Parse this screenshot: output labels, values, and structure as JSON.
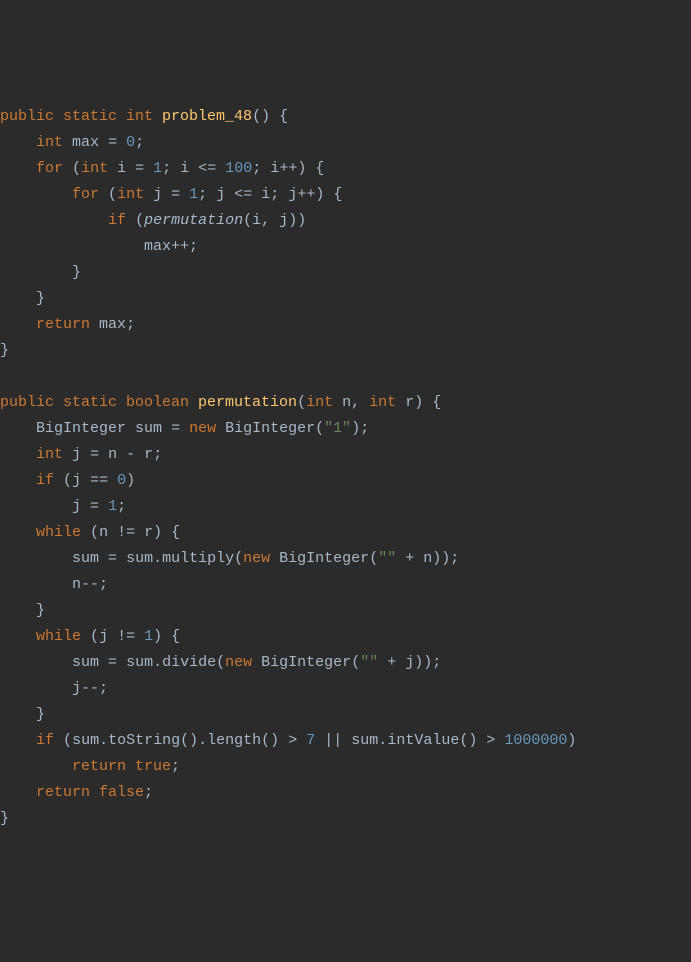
{
  "code": {
    "fn1_mods": "public static int",
    "fn1_name": "problem_48",
    "fn1_l1_type": "int",
    "fn1_l1_var": "max",
    "fn1_l1_val": "0",
    "fn1_for_kw": "for",
    "fn1_for_init_type": "int",
    "fn1_for_init_var": "i",
    "fn1_for_init_val": "1",
    "fn1_for_cond_var": "i",
    "fn1_for_cond_val": "100",
    "fn1_for_inc": "i++",
    "fn1_for2_init_type": "int",
    "fn1_for2_init_var": "j",
    "fn1_for2_init_val": "1",
    "fn1_for2_cond_var": "j",
    "fn1_for2_cond_rhs": "i",
    "fn1_for2_inc": "j++",
    "fn1_if_kw": "if",
    "fn1_if_call": "permutation",
    "fn1_if_arg1": "i",
    "fn1_if_arg2": "j",
    "fn1_inc": "max++",
    "fn1_ret_kw": "return",
    "fn1_ret_var": "max",
    "fn2_mods": "public static boolean",
    "fn2_name": "permutation",
    "fn2_p1_type": "int",
    "fn2_p1_name": "n",
    "fn2_p2_type": "int",
    "fn2_p2_name": "r",
    "fn2_l1_type": "BigInteger",
    "fn2_l1_var": "sum",
    "fn2_l1_new": "new",
    "fn2_l1_ctor": "BigInteger",
    "fn2_l1_arg": "\"1\"",
    "fn2_l2_type": "int",
    "fn2_l2_var": "j",
    "fn2_l2_expr_lhs": "n",
    "fn2_l2_expr_rhs": "r",
    "fn2_if1_kw": "if",
    "fn2_if1_var": "j",
    "fn2_if1_val": "0",
    "fn2_if1_body_var": "j",
    "fn2_if1_body_val": "1",
    "fn2_while_kw": "while",
    "fn2_w1_cond_lhs": "n",
    "fn2_w1_cond_rhs": "r",
    "fn2_w1_l1_lhs": "sum",
    "fn2_w1_l1_obj": "sum",
    "fn2_w1_l1_method": "multiply",
    "fn2_w1_l1_new": "new",
    "fn2_w1_l1_ctor": "BigInteger",
    "fn2_w1_l1_str": "\"\"",
    "fn2_w1_l1_var": "n",
    "fn2_w1_l2": "n--",
    "fn2_w2_cond_lhs": "j",
    "fn2_w2_cond_val": "1",
    "fn2_w2_l1_lhs": "sum",
    "fn2_w2_l1_obj": "sum",
    "fn2_w2_l1_method": "divide",
    "fn2_w2_l1_new": "new",
    "fn2_w2_l1_ctor": "BigInteger",
    "fn2_w2_l1_str": "\"\"",
    "fn2_w2_l1_var": "j",
    "fn2_w2_l2": "j--",
    "fn2_if2_kw": "if",
    "fn2_if2_obj1": "sum",
    "fn2_if2_m1": "toString",
    "fn2_if2_m2": "length",
    "fn2_if2_v1": "7",
    "fn2_if2_obj2": "sum",
    "fn2_if2_m3": "intValue",
    "fn2_if2_v2": "1000000",
    "fn2_ret_true_kw": "return true",
    "fn2_ret_false_kw": "return false"
  }
}
